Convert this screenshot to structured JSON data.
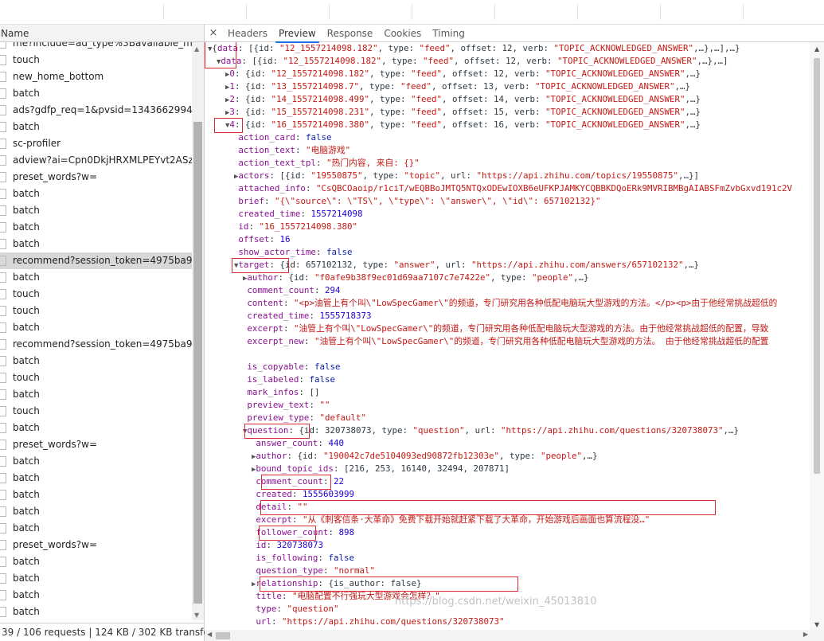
{
  "network": {
    "name_header": "Name",
    "requests": [
      {
        "name": "me?include=ad_type%3Bavailable_messa"
      },
      {
        "name": "touch"
      },
      {
        "name": "new_home_bottom"
      },
      {
        "name": "batch"
      },
      {
        "name": "ads?gdfp_req=1&pvsid=13436629944681"
      },
      {
        "name": "batch"
      },
      {
        "name": "sc-profiler"
      },
      {
        "name": "adview?ai=Cpn0DkjHRXMLPEYvt2ASz2IjA"
      },
      {
        "name": "preset_words?w="
      },
      {
        "name": "batch"
      },
      {
        "name": "batch"
      },
      {
        "name": "batch"
      },
      {
        "name": "batch"
      },
      {
        "name": "recommend?session_token=4975ba96688",
        "selected": true
      },
      {
        "name": "batch"
      },
      {
        "name": "touch"
      },
      {
        "name": "touch"
      },
      {
        "name": "batch"
      },
      {
        "name": "recommend?session_token=4975ba96688"
      },
      {
        "name": "batch"
      },
      {
        "name": "touch"
      },
      {
        "name": "batch"
      },
      {
        "name": "touch"
      },
      {
        "name": "batch"
      },
      {
        "name": "preset_words?w="
      },
      {
        "name": "batch"
      },
      {
        "name": "batch"
      },
      {
        "name": "batch"
      },
      {
        "name": "batch"
      },
      {
        "name": "batch"
      },
      {
        "name": "preset_words?w="
      },
      {
        "name": "batch"
      },
      {
        "name": "batch"
      },
      {
        "name": "batch"
      },
      {
        "name": "batch"
      }
    ],
    "status_bar": "39 / 106 requests | 124 KB / 302 KB transferre..."
  },
  "detail": {
    "close_glyph": "×",
    "tabs": [
      "Headers",
      "Preview",
      "Response",
      "Cookies",
      "Timing"
    ],
    "active_tab": "Preview"
  },
  "preview_lines": [
    {
      "d": 0,
      "t": "down",
      "parts": [
        [
          "p",
          "{"
        ],
        [
          "k",
          "data"
        ],
        [
          "p",
          ": [{id: "
        ],
        [
          "s",
          "\"12_1557214098.182\""
        ],
        [
          "p",
          ", type: "
        ],
        [
          "s",
          "\"feed\""
        ],
        [
          "p",
          ", offset: 12, verb: "
        ],
        [
          "s",
          "\"TOPIC_ACKNOWLEDGED_ANSWER\""
        ],
        [
          "p",
          ",…},…],…}"
        ]
      ]
    },
    {
      "d": 1,
      "t": "down",
      "parts": [
        [
          "k",
          "data"
        ],
        [
          "p",
          ": [{id: "
        ],
        [
          "s",
          "\"12_1557214098.182\""
        ],
        [
          "p",
          ", type: "
        ],
        [
          "s",
          "\"feed\""
        ],
        [
          "p",
          ", offset: 12, verb: "
        ],
        [
          "s",
          "\"TOPIC_ACKNOWLEDGED_ANSWER\""
        ],
        [
          "p",
          ",…},…]"
        ]
      ]
    },
    {
      "d": 2,
      "t": "right",
      "parts": [
        [
          "k",
          "0"
        ],
        [
          "p",
          ": {id: "
        ],
        [
          "s",
          "\"12_1557214098.182\""
        ],
        [
          "p",
          ", type: "
        ],
        [
          "s",
          "\"feed\""
        ],
        [
          "p",
          ", offset: 12, verb: "
        ],
        [
          "s",
          "\"TOPIC_ACKNOWLEDGED_ANSWER\""
        ],
        [
          "p",
          ",…}"
        ]
      ]
    },
    {
      "d": 2,
      "t": "right",
      "parts": [
        [
          "k",
          "1"
        ],
        [
          "p",
          ": {id: "
        ],
        [
          "s",
          "\"13_1557214098.7\""
        ],
        [
          "p",
          ", type: "
        ],
        [
          "s",
          "\"feed\""
        ],
        [
          "p",
          ", offset: 13, verb: "
        ],
        [
          "s",
          "\"TOPIC_ACKNOWLEDGED_ANSWER\""
        ],
        [
          "p",
          ",…}"
        ]
      ]
    },
    {
      "d": 2,
      "t": "right",
      "parts": [
        [
          "k",
          "2"
        ],
        [
          "p",
          ": {id: "
        ],
        [
          "s",
          "\"14_1557214098.499\""
        ],
        [
          "p",
          ", type: "
        ],
        [
          "s",
          "\"feed\""
        ],
        [
          "p",
          ", offset: 14, verb: "
        ],
        [
          "s",
          "\"TOPIC_ACKNOWLEDGED_ANSWER\""
        ],
        [
          "p",
          ",…}"
        ]
      ]
    },
    {
      "d": 2,
      "t": "right",
      "parts": [
        [
          "k",
          "3"
        ],
        [
          "p",
          ": {id: "
        ],
        [
          "s",
          "\"15_1557214098.231\""
        ],
        [
          "p",
          ", type: "
        ],
        [
          "s",
          "\"feed\""
        ],
        [
          "p",
          ", offset: 15, verb: "
        ],
        [
          "s",
          "\"TOPIC_ACKNOWLEDGED_ANSWER\""
        ],
        [
          "p",
          ",…}"
        ]
      ]
    },
    {
      "d": 2,
      "t": "down",
      "parts": [
        [
          "k",
          "4"
        ],
        [
          "p",
          ": {id: "
        ],
        [
          "s",
          "\"16_1557214098.380\""
        ],
        [
          "p",
          ", type: "
        ],
        [
          "s",
          "\"feed\""
        ],
        [
          "p",
          ", offset: 16, verb: "
        ],
        [
          "s",
          "\"TOPIC_ACKNOWLEDGED_ANSWER\""
        ],
        [
          "p",
          ",…}"
        ]
      ]
    },
    {
      "d": 3,
      "t": "",
      "parts": [
        [
          "k",
          "action_card"
        ],
        [
          "p",
          ": "
        ],
        [
          "b",
          "false"
        ]
      ]
    },
    {
      "d": 3,
      "t": "",
      "parts": [
        [
          "k",
          "action_text"
        ],
        [
          "p",
          ": "
        ],
        [
          "s",
          "\"电脑游戏\""
        ]
      ]
    },
    {
      "d": 3,
      "t": "",
      "parts": [
        [
          "k",
          "action_text_tpl"
        ],
        [
          "p",
          ": "
        ],
        [
          "s",
          "\"热门内容, 来自: {}\""
        ]
      ]
    },
    {
      "d": 3,
      "t": "right",
      "parts": [
        [
          "k",
          "actors"
        ],
        [
          "p",
          ": [{id: "
        ],
        [
          "s",
          "\"19550875\""
        ],
        [
          "p",
          ", type: "
        ],
        [
          "s",
          "\"topic\""
        ],
        [
          "p",
          ", url: "
        ],
        [
          "s",
          "\"https://api.zhihu.com/topics/19550875\""
        ],
        [
          "p",
          ",…}]"
        ]
      ]
    },
    {
      "d": 3,
      "t": "",
      "parts": [
        [
          "k",
          "attached_info"
        ],
        [
          "p",
          ": "
        ],
        [
          "s",
          "\"CsQBCOaoip/r1ciT/wEQBBoJMTQ5NTQxODEwIOXB6eUFKPJAMKYCQBBKDQoERk9MVRIBMBgAIABSFmZvbGxvd191c2V"
        ]
      ]
    },
    {
      "d": 3,
      "t": "",
      "parts": [
        [
          "k",
          "brief"
        ],
        [
          "p",
          ": "
        ],
        [
          "s",
          "\"{\\\"source\\\": \\\"TS\\\", \\\"type\\\": \\\"answer\\\", \\\"id\\\": 657102132}\""
        ]
      ]
    },
    {
      "d": 3,
      "t": "",
      "parts": [
        [
          "k",
          "created_time"
        ],
        [
          "p",
          ": "
        ],
        [
          "n",
          "1557214098"
        ]
      ]
    },
    {
      "d": 3,
      "t": "",
      "parts": [
        [
          "k",
          "id"
        ],
        [
          "p",
          ": "
        ],
        [
          "s",
          "\"16_1557214098.380\""
        ]
      ]
    },
    {
      "d": 3,
      "t": "",
      "parts": [
        [
          "k",
          "offset"
        ],
        [
          "p",
          ": "
        ],
        [
          "n",
          "16"
        ]
      ]
    },
    {
      "d": 3,
      "t": "",
      "parts": [
        [
          "k",
          "show_actor_time"
        ],
        [
          "p",
          ": "
        ],
        [
          "b",
          "false"
        ]
      ]
    },
    {
      "d": 3,
      "t": "down",
      "parts": [
        [
          "k",
          "target"
        ],
        [
          "p",
          ": {id: 657102132, type: "
        ],
        [
          "s",
          "\"answer\""
        ],
        [
          "p",
          ", url: "
        ],
        [
          "s",
          "\"https://api.zhihu.com/answers/657102132\""
        ],
        [
          "p",
          ",…}"
        ]
      ]
    },
    {
      "d": 4,
      "t": "right",
      "parts": [
        [
          "k",
          "author"
        ],
        [
          "p",
          ": {id: "
        ],
        [
          "s",
          "\"f0afe9b38f9ec01d69aa7107c7e7422e\""
        ],
        [
          "p",
          ", type: "
        ],
        [
          "s",
          "\"people\""
        ],
        [
          "p",
          ",…}"
        ]
      ]
    },
    {
      "d": 4,
      "t": "",
      "parts": [
        [
          "k",
          "comment_count"
        ],
        [
          "p",
          ": "
        ],
        [
          "n",
          "294"
        ]
      ]
    },
    {
      "d": 4,
      "t": "",
      "parts": [
        [
          "k",
          "content"
        ],
        [
          "p",
          ": "
        ],
        [
          "s",
          "\"<p>油管上有个叫\\\"LowSpecGamer\\\"的频道，专门研究用各种低配电脑玩大型游戏的方法。</p><p>由于他经常挑战超低的"
        ]
      ]
    },
    {
      "d": 4,
      "t": "",
      "parts": [
        [
          "k",
          "created_time"
        ],
        [
          "p",
          ": "
        ],
        [
          "n",
          "1555718373"
        ]
      ]
    },
    {
      "d": 4,
      "t": "",
      "parts": [
        [
          "k",
          "excerpt"
        ],
        [
          "p",
          ": "
        ],
        [
          "s",
          "\"油管上有个叫\\\"LowSpecGamer\\\"的频道，专门研究用各种低配电脑玩大型游戏的方法。由于他经常挑战超低的配置，导致"
        ]
      ]
    },
    {
      "d": 4,
      "t": "",
      "parts": [
        [
          "k",
          "excerpt_new"
        ],
        [
          "p",
          ": "
        ],
        [
          "s",
          "\"油管上有个叫\\\"LowSpecGamer\\\"的频道，专门研究用各种低配电脑玩大型游戏的方法。 由于他经常挑战超低的配置"
        ]
      ]
    },
    {
      "d": 4,
      "t": "",
      "parts": []
    },
    {
      "d": 4,
      "t": "",
      "parts": [
        [
          "k",
          "is_copyable"
        ],
        [
          "p",
          ": "
        ],
        [
          "b",
          "false"
        ]
      ]
    },
    {
      "d": 4,
      "t": "",
      "parts": [
        [
          "k",
          "is_labeled"
        ],
        [
          "p",
          ": "
        ],
        [
          "b",
          "false"
        ]
      ]
    },
    {
      "d": 4,
      "t": "",
      "parts": [
        [
          "k",
          "mark_infos"
        ],
        [
          "p",
          ": []"
        ]
      ]
    },
    {
      "d": 4,
      "t": "",
      "parts": [
        [
          "k",
          "preview_text"
        ],
        [
          "p",
          ": "
        ],
        [
          "s",
          "\"\""
        ]
      ]
    },
    {
      "d": 4,
      "t": "",
      "parts": [
        [
          "k",
          "preview_type"
        ],
        [
          "p",
          ": "
        ],
        [
          "s",
          "\"default\""
        ]
      ]
    },
    {
      "d": 4,
      "t": "down",
      "parts": [
        [
          "k",
          "question"
        ],
        [
          "p",
          ": {id: 320738073, type: "
        ],
        [
          "s",
          "\"question\""
        ],
        [
          "p",
          ", url: "
        ],
        [
          "s",
          "\"https://api.zhihu.com/questions/320738073\""
        ],
        [
          "p",
          ",…}"
        ]
      ]
    },
    {
      "d": 5,
      "t": "",
      "parts": [
        [
          "k",
          "answer_count"
        ],
        [
          "p",
          ": "
        ],
        [
          "n",
          "440"
        ]
      ]
    },
    {
      "d": 5,
      "t": "right",
      "parts": [
        [
          "k",
          "author"
        ],
        [
          "p",
          ": {id: "
        ],
        [
          "s",
          "\"190042c7de5104093ed90872fb12303e\""
        ],
        [
          "p",
          ", type: "
        ],
        [
          "s",
          "\"people\""
        ],
        [
          "p",
          ",…}"
        ]
      ]
    },
    {
      "d": 5,
      "t": "right",
      "parts": [
        [
          "k",
          "bound_topic_ids"
        ],
        [
          "p",
          ": [216, 253, 16140, 32494, 207871]"
        ]
      ]
    },
    {
      "d": 5,
      "t": "",
      "parts": [
        [
          "k",
          "comment_count"
        ],
        [
          "p",
          ": "
        ],
        [
          "n",
          "22"
        ]
      ]
    },
    {
      "d": 5,
      "t": "",
      "parts": [
        [
          "k",
          "created"
        ],
        [
          "p",
          ": "
        ],
        [
          "n",
          "1555603999"
        ]
      ]
    },
    {
      "d": 5,
      "t": "",
      "parts": [
        [
          "k",
          "detail"
        ],
        [
          "p",
          ": "
        ],
        [
          "s",
          "\"\""
        ]
      ]
    },
    {
      "d": 5,
      "t": "",
      "parts": [
        [
          "k",
          "excerpt"
        ],
        [
          "p",
          ": "
        ],
        [
          "s",
          "\"从《刺客信条·大革命》免费下载开始就赶紧下载了大革命，开始游戏后画面也算流程没…\""
        ]
      ]
    },
    {
      "d": 5,
      "t": "",
      "parts": [
        [
          "k",
          "follower_count"
        ],
        [
          "p",
          ": "
        ],
        [
          "n",
          "898"
        ]
      ]
    },
    {
      "d": 5,
      "t": "",
      "parts": [
        [
          "k",
          "id"
        ],
        [
          "p",
          ": "
        ],
        [
          "n",
          "320738073"
        ]
      ]
    },
    {
      "d": 5,
      "t": "",
      "parts": [
        [
          "k",
          "is_following"
        ],
        [
          "p",
          ": "
        ],
        [
          "b",
          "false"
        ]
      ]
    },
    {
      "d": 5,
      "t": "",
      "parts": [
        [
          "k",
          "question_type"
        ],
        [
          "p",
          ": "
        ],
        [
          "s",
          "\"normal\""
        ]
      ]
    },
    {
      "d": 5,
      "t": "right",
      "parts": [
        [
          "k",
          "relationship"
        ],
        [
          "p",
          ": {is_author: false}"
        ]
      ]
    },
    {
      "d": 5,
      "t": "",
      "parts": [
        [
          "k",
          "title"
        ],
        [
          "p",
          ": "
        ],
        [
          "s",
          "\"电脑配置不行强玩大型游戏会怎样？\""
        ]
      ]
    },
    {
      "d": 5,
      "t": "",
      "parts": [
        [
          "k",
          "type"
        ],
        [
          "p",
          ": "
        ],
        [
          "s",
          "\"question\""
        ]
      ]
    },
    {
      "d": 5,
      "t": "",
      "parts": [
        [
          "k",
          "url"
        ],
        [
          "p",
          ": "
        ],
        [
          "s",
          "\"https://api.zhihu.com/questions/320738073\""
        ]
      ]
    }
  ],
  "watermark": "https://blog.csdn.net/weixin_45013810",
  "annotation_color": "#e0282c"
}
